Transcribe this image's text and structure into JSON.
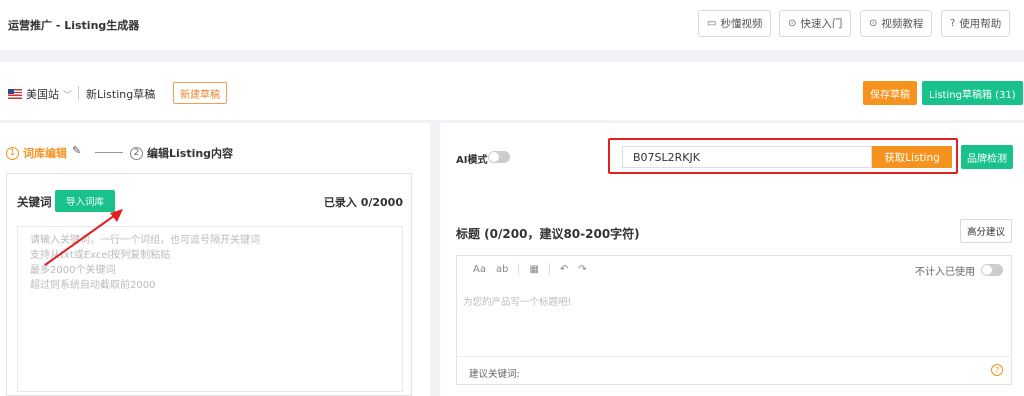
{
  "header": {
    "title": "运营推广 - Listing生成器",
    "buttons": [
      {
        "label": "秒懂视频",
        "icon": "video-icon"
      },
      {
        "label": "快速入门",
        "icon": "play-circle-icon"
      },
      {
        "label": "视频教程",
        "icon": "play-circle-icon"
      },
      {
        "label": "使用帮助",
        "icon": "help-circle-icon"
      }
    ]
  },
  "draftbar": {
    "site": "美国站",
    "draft_name": "新Listing草稿",
    "new_draft": "新建草稿",
    "save_draft": "保存草稿",
    "draft_box": "Listing草稿箱 (31)"
  },
  "steps": {
    "step1_num": "1",
    "step1_label": "词库编辑",
    "step2_num": "2",
    "step2_label": "编辑Listing内容"
  },
  "keywords": {
    "title": "关键词",
    "import_button": "导入词库",
    "count": "已录入 0/2000",
    "placeholder": "请输入关键词，一行一个词组，也可逗号隔开关键词\n支持从txt或Excel按列复制粘贴\n最多2000个关键词\n超过则系统自动截取前2000"
  },
  "right": {
    "ai_mode": "AI模式",
    "asin_value": "B07SL2RKJK",
    "fetch_button": "获取Listing",
    "brand_button": "品牌检测",
    "title_label": "标题 (0/200，建议80-200字符)",
    "advise_button": "高分建议",
    "toolbar": {
      "aa": "Aa",
      "ab": "ab",
      "undo": "↶",
      "redo": "↷"
    },
    "exclude_label": "不计入已使用",
    "editor_placeholder": "为您的产品写一个标题吧!",
    "suggest_label": "建议关键词:"
  },
  "colors": {
    "accent_orange": "#f6921e",
    "accent_green": "#19c28a",
    "highlight_red": "#e02020"
  }
}
